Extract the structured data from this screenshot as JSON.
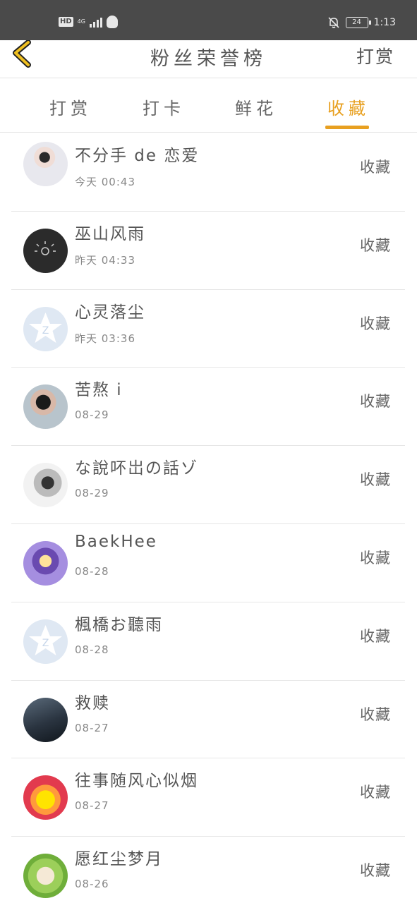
{
  "status_bar": {
    "hd_label": "HD",
    "network_label": "4G",
    "signal_icon": "signal-bars-icon",
    "qq_icon": "qq-penguin-icon",
    "mute_icon": "bell-off-icon",
    "battery_level": "24",
    "time": "1:13"
  },
  "nav": {
    "back_icon": "chevron-left-icon",
    "title": "粉丝荣誉榜",
    "action_label": "打赏"
  },
  "tabs": [
    {
      "label": "打赏",
      "active": false
    },
    {
      "label": "打卡",
      "active": false
    },
    {
      "label": "鲜花",
      "active": false
    },
    {
      "label": "收藏",
      "active": true
    }
  ],
  "accent_color": "#e8a020",
  "list": [
    {
      "name": "不分手 de 恋爱",
      "time": "今天 00:43",
      "action": "收藏"
    },
    {
      "name": "巫山风雨",
      "time": "昨天 04:33",
      "action": "收藏"
    },
    {
      "name": "心灵落尘",
      "time": "昨天 03:36",
      "action": "收藏"
    },
    {
      "name": "苦熬 i",
      "time": "08-29",
      "action": "收藏"
    },
    {
      "name": "な說吥岀の話ゾ",
      "time": "08-29",
      "action": "收藏"
    },
    {
      "name": "BaekHee",
      "time": "08-28",
      "action": "收藏"
    },
    {
      "name": "楓橋お聽雨",
      "time": "08-28",
      "action": "收藏"
    },
    {
      "name": "救赎",
      "time": "08-27",
      "action": "收藏"
    },
    {
      "name": "往事随风心似烟",
      "time": "08-27",
      "action": "收藏"
    },
    {
      "name": "愿红尘梦月",
      "time": "08-26",
      "action": "收藏"
    }
  ]
}
